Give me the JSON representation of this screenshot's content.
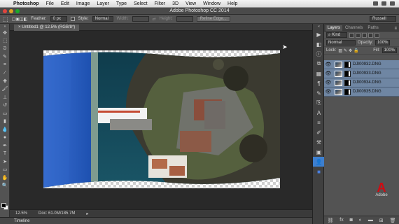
{
  "menubar": {
    "items": [
      "Photoshop",
      "File",
      "Edit",
      "Image",
      "Layer",
      "Type",
      "Select",
      "Filter",
      "3D",
      "View",
      "Window",
      "Help"
    ]
  },
  "window": {
    "title": "Adobe Photoshop CC 2014"
  },
  "options": {
    "feather_label": "Feather:",
    "feather_value": "0 px",
    "style_label": "Style:",
    "style_value": "Normal",
    "width_label": "Width:",
    "height_label": "Height:",
    "refine_edge": "Refine Edge...",
    "workspace": "Russell"
  },
  "document": {
    "tab_title": "Untitled1 @ 12.5% (RGB/8*)",
    "close_icon": "×"
  },
  "status": {
    "zoom": "12.5%",
    "doc_size": "Doc: 61.0M/185.7M"
  },
  "timeline": {
    "label": "Timeline"
  },
  "layers_panel": {
    "tabs": [
      "Layers",
      "Channels",
      "Paths"
    ],
    "kind_label": "Kind",
    "blend_mode": "Normal",
    "opacity_label": "Opacity:",
    "opacity_value": "100%",
    "lock_label": "Lock:",
    "fill_label": "Fill:",
    "fill_value": "100%",
    "layers": [
      {
        "name": "DJI00932.DNG"
      },
      {
        "name": "DJI00933.DNG"
      },
      {
        "name": "DJI00934.DNG"
      },
      {
        "name": "DJI00935.DNG"
      }
    ],
    "selection_color": "#6f86a3"
  },
  "branding": {
    "logo_text": "Adobe"
  }
}
